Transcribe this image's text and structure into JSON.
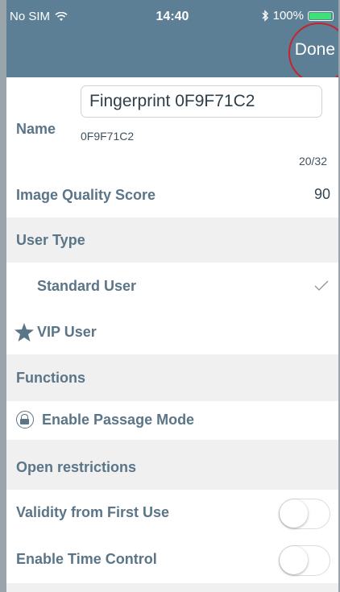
{
  "status": {
    "carrier": "No SIM",
    "time": "14:40",
    "battery": "100%"
  },
  "nav": {
    "done_label": "Done"
  },
  "name_field": {
    "value": "Fingerprint 0F9F71C2",
    "label": "Name",
    "sub_id": "0F9F71C2",
    "char_count": "20/32"
  },
  "image_quality": {
    "label": "Image Quality Score",
    "value": "90"
  },
  "user_type": {
    "header": "User Type",
    "options": [
      {
        "label": "Standard User",
        "selected": true
      },
      {
        "label": "VIP User",
        "selected": false
      }
    ]
  },
  "functions": {
    "header": "Functions",
    "passage_mode": "Enable Passage Mode"
  },
  "open_restrictions": {
    "header": "Open restrictions",
    "validity_label": "Validity from First Use",
    "validity_on": false,
    "time_control_label": "Enable Time Control",
    "time_control_on": false
  },
  "colors": {
    "header_bg": "#5c7f95",
    "accent_text": "#5b7588",
    "highlight_circle": "#c8232c",
    "battery": "#3ee07a"
  }
}
